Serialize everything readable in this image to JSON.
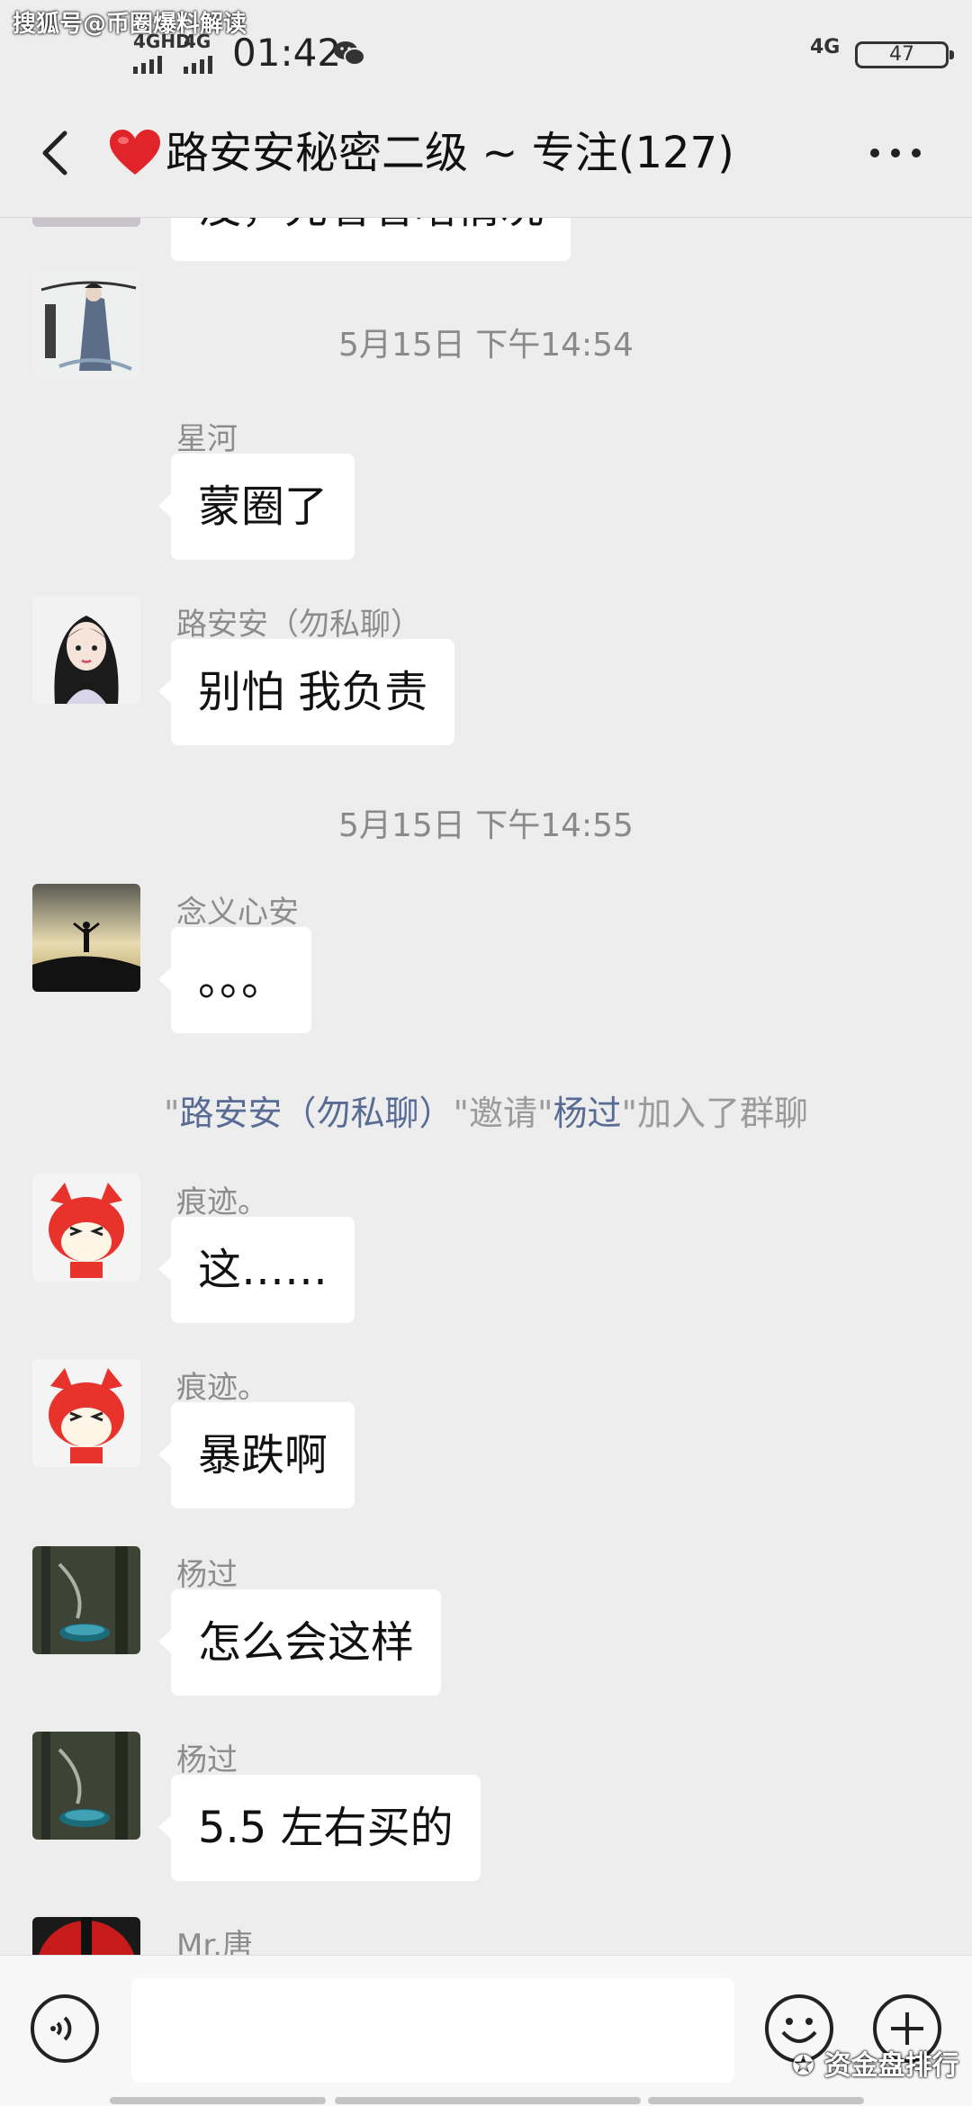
{
  "watermark": {
    "top": "搜狐号@币圈爆料解读",
    "bottom": "资金盘排行"
  },
  "status_bar": {
    "signal_1": "4GHD",
    "signal_2": "4G",
    "time": "01:42",
    "network": "4G",
    "battery": "47"
  },
  "header": {
    "title": "路安安秘密二级 ~ 专注(127)"
  },
  "partial_bubble": {
    "text": "没，先看看啥情况"
  },
  "messages": [
    {
      "type": "timestamp",
      "text": "5月15日 下午14:54"
    },
    {
      "type": "message",
      "sender": "星河",
      "text": "蒙圈了",
      "avatar": "avatar-ink-painting"
    },
    {
      "type": "message",
      "sender": "路安安（勿私聊）",
      "text": "别怕 我负责",
      "avatar": "avatar-girl-portrait"
    },
    {
      "type": "timestamp",
      "text": "5月15日 下午14:55"
    },
    {
      "type": "message",
      "sender": "念义心安",
      "text": "。。。",
      "avatar": "avatar-sunset-silhouette"
    },
    {
      "type": "system",
      "inviter": "路安安（勿私聊）",
      "verb": "邀请",
      "invitee": "杨过",
      "suffix": "加入了群聊"
    },
    {
      "type": "message",
      "sender": "痕迹。",
      "text": "这……",
      "avatar": "avatar-red-fox"
    },
    {
      "type": "message",
      "sender": "痕迹。",
      "text": "暴跌啊",
      "avatar": "avatar-red-fox"
    },
    {
      "type": "message",
      "sender": "杨过",
      "text": "怎么会这样",
      "avatar": "avatar-forest"
    },
    {
      "type": "message",
      "sender": "杨过",
      "text": "5.5 左右买的",
      "avatar": "avatar-forest"
    },
    {
      "type": "message",
      "sender": "Mr.唐",
      "avatar": "avatar-red-mask"
    }
  ],
  "colors": {
    "background": "#ededed",
    "bubble": "#ffffff",
    "link": "#576b95",
    "muted": "#8a8a8a"
  },
  "input": {
    "placeholder": ""
  }
}
